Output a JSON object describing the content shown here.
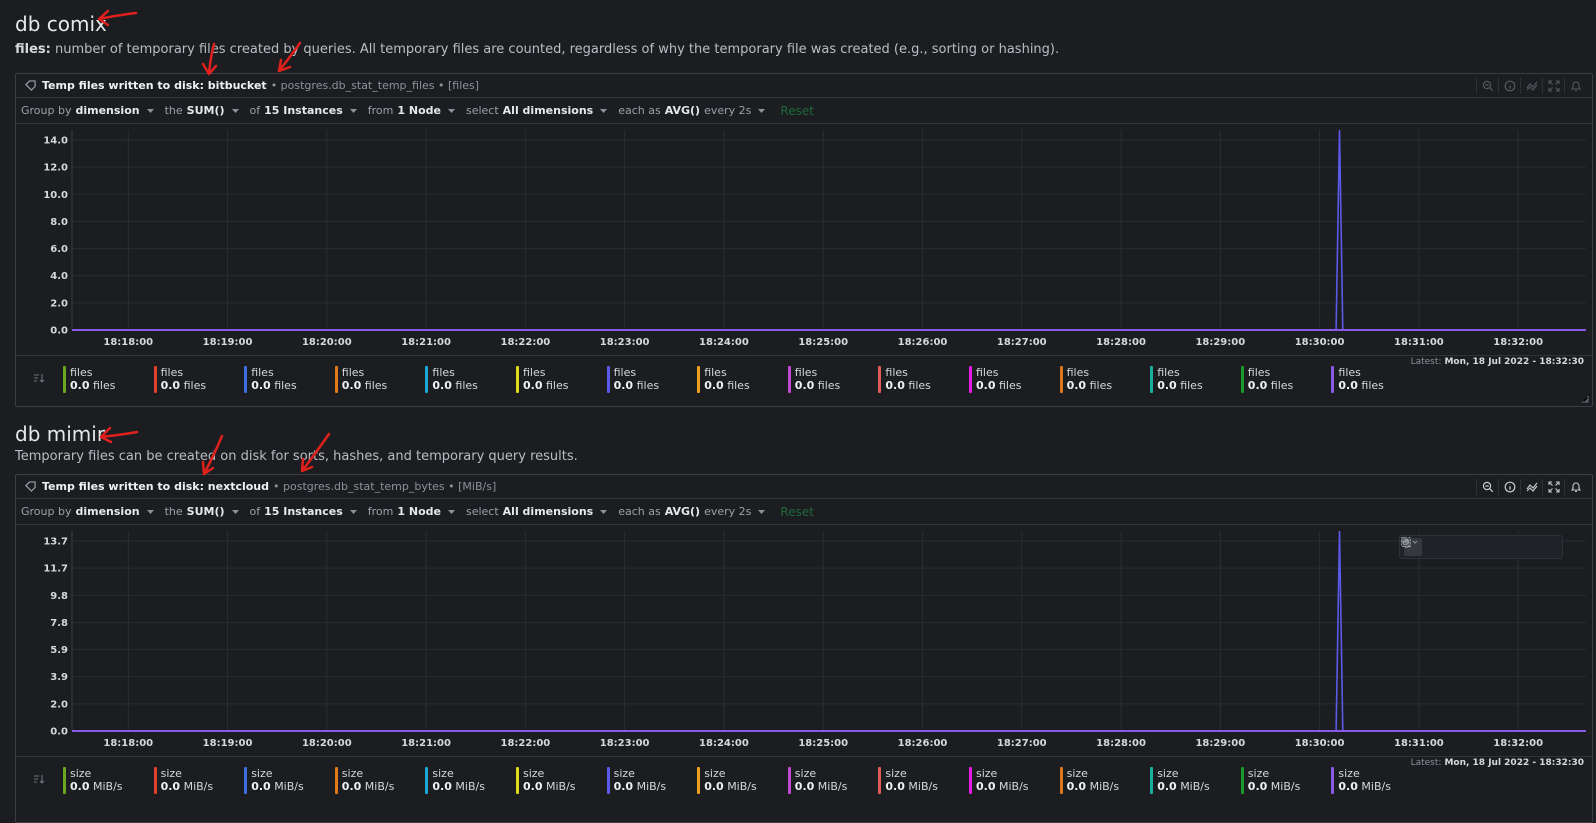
{
  "sections": [
    {
      "title": "db comix",
      "desc_label": "files:",
      "desc_text": " number of temporary files created by queries. All temporary files are counted, regardless of why the temporary file was created (e.g., sorting or hashing).",
      "chart_title": "Temp files written to disk: bitbucket",
      "chart_context": "• postgres.db_stat_temp_files • [files]",
      "groupbar": {
        "group_by_prefix": "Group by",
        "group_by_value": "dimension",
        "agg_prefix": "the",
        "agg_value": "SUM()",
        "of_prefix": "of",
        "of_value": "15 Instances",
        "from_prefix": "from",
        "from_value": "1 Node",
        "select_prefix": "select",
        "select_value": "All dimensions",
        "each_prefix": "each as",
        "each_value": "AVG()",
        "every_text": "every 2s",
        "reset": "Reset"
      },
      "latest_label": "Latest:",
      "latest_value": "Mon, 18 Jul 2022 - 18:32:30",
      "legend_name": "files",
      "legend_value": "0.0",
      "legend_unit": "files"
    },
    {
      "title": "db mimir",
      "desc_label": "",
      "desc_text": "Temporary files can be created on disk for sorts, hashes, and temporary query results.",
      "chart_title": "Temp files written to disk: nextcloud",
      "chart_context": "• postgres.db_stat_temp_bytes • [MiB/s]",
      "groupbar": {
        "group_by_prefix": "Group by",
        "group_by_value": "dimension",
        "agg_prefix": "the",
        "agg_value": "SUM()",
        "of_prefix": "of",
        "of_value": "15 Instances",
        "from_prefix": "from",
        "from_value": "1 Node",
        "select_prefix": "select",
        "select_value": "All dimensions",
        "each_prefix": "each as",
        "each_value": "AVG()",
        "every_text": "every 2s",
        "reset": "Reset"
      },
      "latest_label": "Latest:",
      "latest_value": "Mon, 18 Jul 2022 - 18:32:30",
      "legend_name": "size",
      "legend_value": "0.0",
      "legend_unit": "MiB/s"
    }
  ],
  "legend_colors": [
    "#6aa822",
    "#e0402a",
    "#3b6ee0",
    "#e07a1a",
    "#1aa8d6",
    "#e0d91a",
    "#5a5ae6",
    "#f0a020",
    "#c04ad0",
    "#e05a5a",
    "#e61ae6",
    "#d8781a",
    "#1ab0a0",
    "#1a9a2a",
    "#8a5ae6"
  ],
  "chart_data": [
    {
      "type": "line",
      "x_ticks": [
        "18:18:00",
        "18:19:00",
        "18:20:00",
        "18:21:00",
        "18:22:00",
        "18:23:00",
        "18:24:00",
        "18:25:00",
        "18:26:00",
        "18:27:00",
        "18:28:00",
        "18:29:00",
        "18:30:00",
        "18:31:00",
        "18:32:00"
      ],
      "y_ticks": [
        "0.0",
        "2.0",
        "4.0",
        "6.0",
        "8.0",
        "10.0",
        "12.0",
        "14.0"
      ],
      "ylim": [
        0,
        15
      ],
      "series": [
        {
          "color": "#5b5ae6",
          "x": [
            "18:17:30",
            "18:30:10",
            "18:30:12",
            "18:30:14",
            "18:32:30"
          ],
          "y": [
            0,
            0,
            15,
            0,
            0
          ]
        }
      ]
    },
    {
      "type": "line",
      "x_ticks": [
        "18:18:00",
        "18:19:00",
        "18:20:00",
        "18:21:00",
        "18:22:00",
        "18:23:00",
        "18:24:00",
        "18:25:00",
        "18:26:00",
        "18:27:00",
        "18:28:00",
        "18:29:00",
        "18:30:00",
        "18:31:00",
        "18:32:00"
      ],
      "y_ticks": [
        "0.0",
        "2.0",
        "3.9",
        "5.9",
        "7.8",
        "9.8",
        "11.7",
        "13.7"
      ],
      "ylim": [
        0,
        14.7
      ],
      "series": [
        {
          "color": "#5b5ae6",
          "x": [
            "18:17:30",
            "18:30:10",
            "18:30:12",
            "18:30:14",
            "18:32:30"
          ],
          "y": [
            0,
            0,
            14.7,
            0,
            0
          ]
        }
      ]
    }
  ]
}
